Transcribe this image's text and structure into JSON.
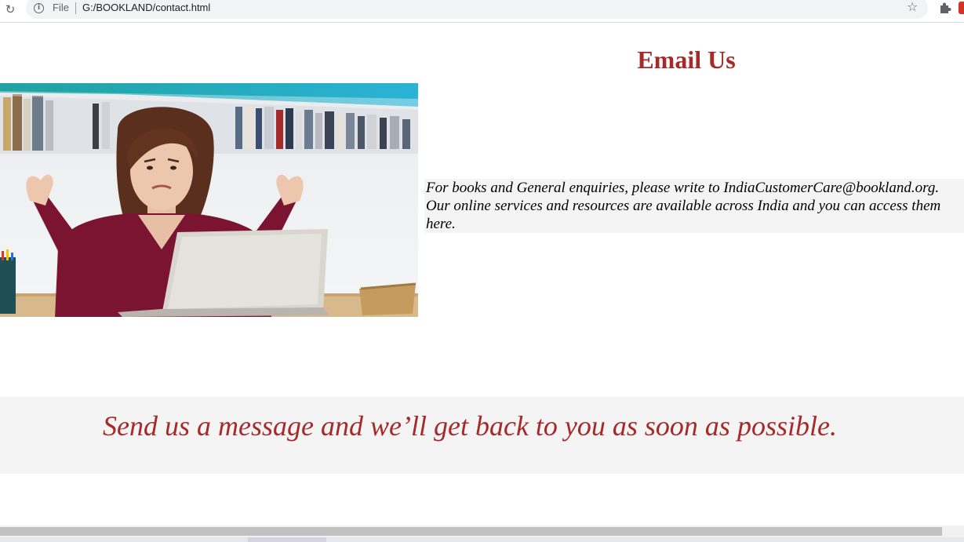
{
  "browser": {
    "scheme_label": "File",
    "url": "G:/BOOKLAND/contact.html",
    "icons": [
      "reload-icon",
      "info-icon",
      "star-icon",
      "extensions-icon"
    ]
  },
  "page": {
    "heading": "Email Us",
    "enquiry_lines": [
      "For books and General enquiries, please write to IndiaCustomerCare@bookland.org.",
      "Our online services and resources are available across India and you can access them",
      "here."
    ],
    "message": "Send us a message and we’ll get back to you as soon as possible.",
    "heading_color": "#a52a2a",
    "band_color": "#f4f4f4"
  }
}
